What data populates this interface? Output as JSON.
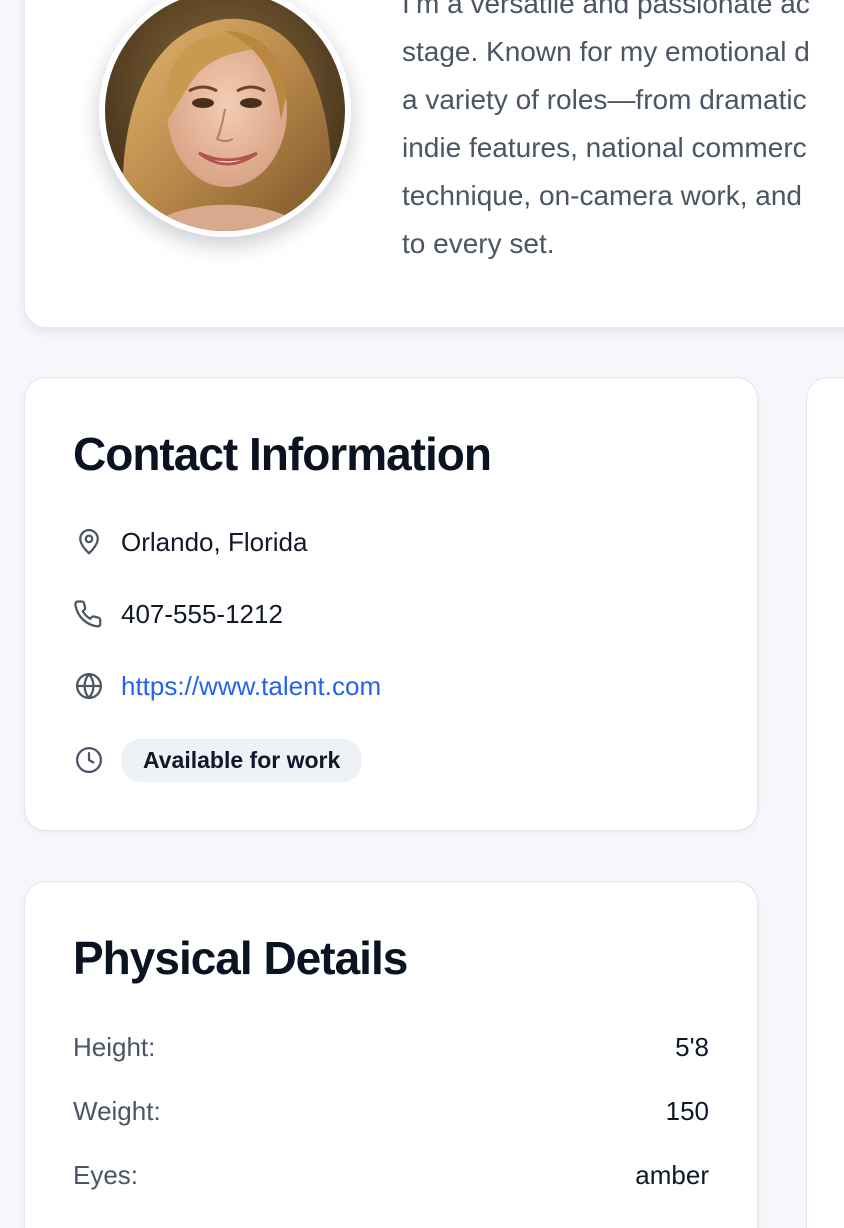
{
  "profile": {
    "bio": "I’m a versatile and passionate ac\nstage. Known for my emotional d\na variety of roles—from dramatic\nindie features, national commerc\ntechnique, on-camera work, and\nto every set."
  },
  "contact": {
    "title": "Contact Information",
    "location": "Orlando, Florida",
    "phone": "407-555-1212",
    "website": "https://www.talent.com",
    "availability": "Available for work"
  },
  "physical": {
    "title": "Physical Details",
    "rows": [
      {
        "label": "Height:",
        "value": "5'8"
      },
      {
        "label": "Weight:",
        "value": "150"
      },
      {
        "label": "Eyes:",
        "value": "amber"
      }
    ]
  },
  "icons": {
    "location": "map-pin-icon",
    "phone": "phone-icon",
    "website": "globe-icon",
    "availability": "clock-icon"
  },
  "colors": {
    "background": "#f5f7fb",
    "link": "#2563eb",
    "badge_bg": "#eef1f6",
    "muted_text": "#4b5563"
  }
}
